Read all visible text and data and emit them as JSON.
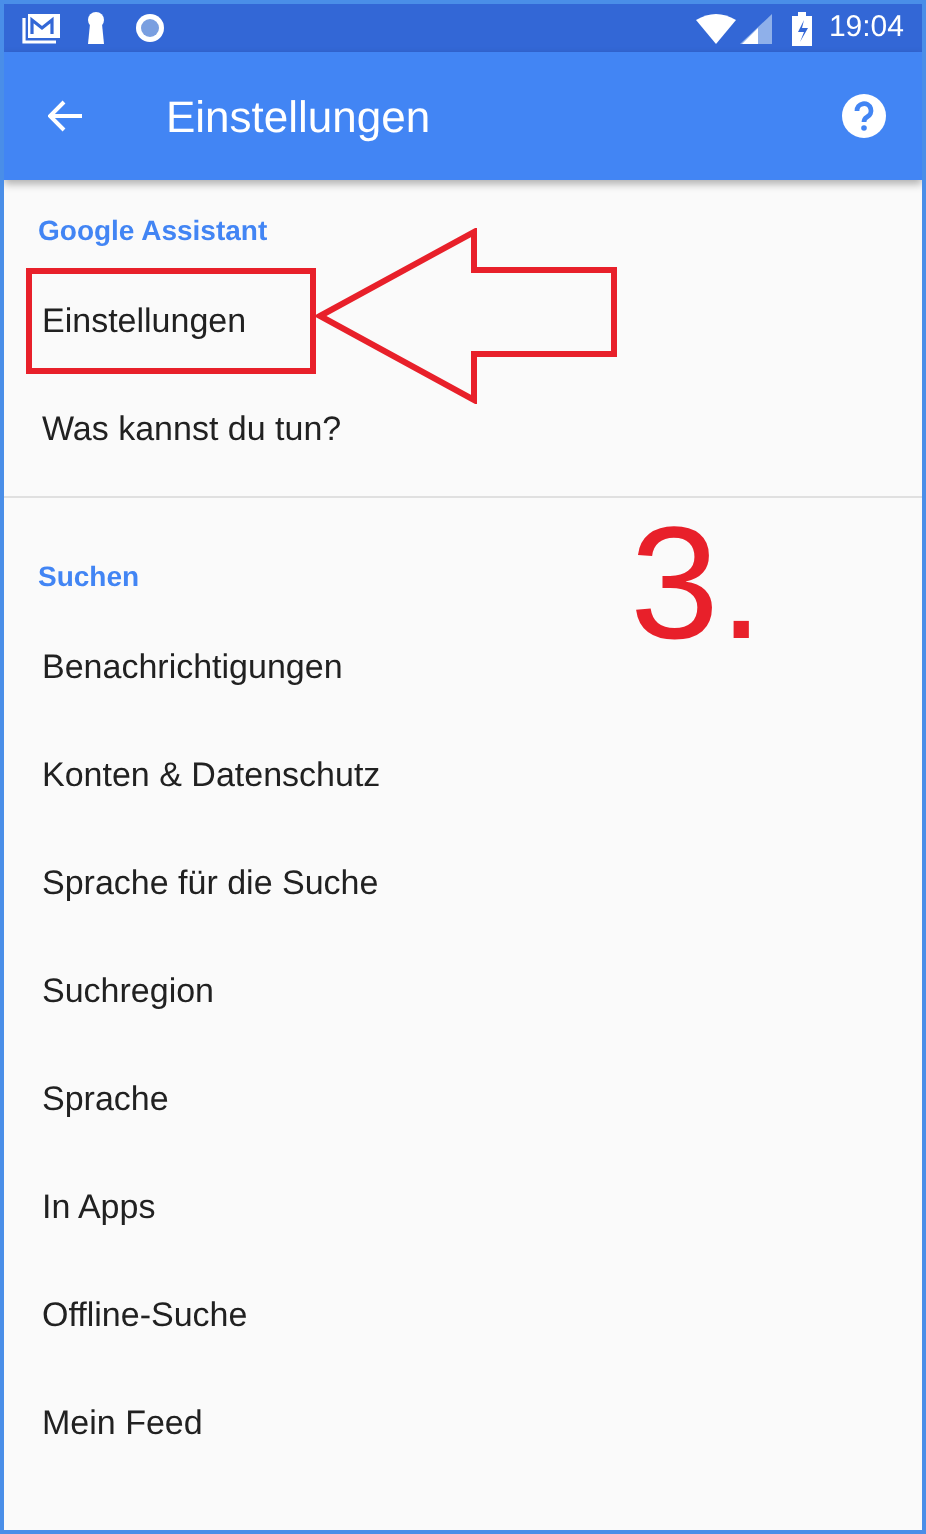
{
  "status_bar": {
    "time": "19:04"
  },
  "app_bar": {
    "title": "Einstellungen"
  },
  "sections": [
    {
      "header": "Google Assistant",
      "items": [
        {
          "label": "Einstellungen",
          "highlighted": true
        },
        {
          "label": "Was kannst du tun?",
          "highlighted": false
        }
      ]
    },
    {
      "header": "Suchen",
      "items": [
        {
          "label": "Benachrichtigungen",
          "highlighted": false
        },
        {
          "label": "Konten & Datenschutz",
          "highlighted": false
        },
        {
          "label": "Sprache für die Suche",
          "highlighted": false
        },
        {
          "label": "Suchregion",
          "highlighted": false
        },
        {
          "label": "Sprache",
          "highlighted": false
        },
        {
          "label": "In Apps",
          "highlighted": false
        },
        {
          "label": "Offline-Suche",
          "highlighted": false
        },
        {
          "label": "Mein Feed",
          "highlighted": false
        }
      ]
    }
  ],
  "annotation": {
    "step": "3."
  }
}
